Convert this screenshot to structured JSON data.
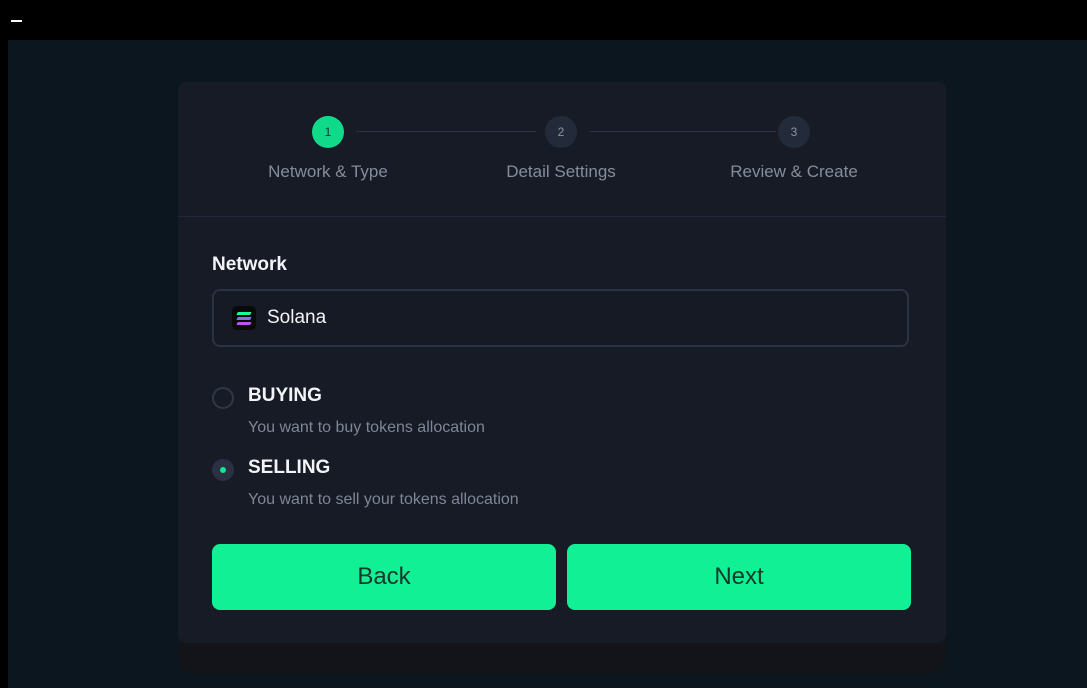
{
  "window": {
    "minimize_glyph": "minimize-icon"
  },
  "stepper": {
    "steps": [
      {
        "number": "1",
        "label": "Network & Type",
        "state": "active"
      },
      {
        "number": "2",
        "label": "Detail Settings",
        "state": "inactive"
      },
      {
        "number": "3",
        "label": "Review & Create",
        "state": "inactive"
      }
    ]
  },
  "network": {
    "label": "Network",
    "selected": "Solana",
    "icon": "solana-logo-icon"
  },
  "type_options": [
    {
      "title": "BUYING",
      "description": "You want to buy tokens allocation",
      "checked": false
    },
    {
      "title": "SELLING",
      "description": "You want to sell your tokens allocation",
      "checked": true
    }
  ],
  "actions": {
    "back_label": "Back",
    "next_label": "Next"
  },
  "colors": {
    "accent": "#11f095",
    "card_bg": "#171b25",
    "page_bg": "#0c161e"
  }
}
